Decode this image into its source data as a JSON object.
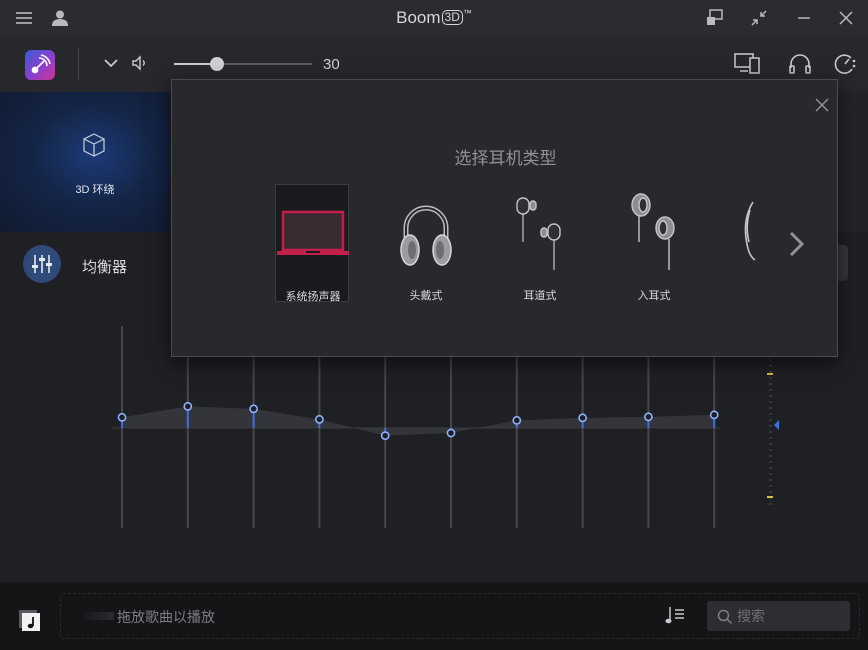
{
  "app": {
    "title_prefix": "Boom",
    "title_badge": "3D",
    "title_tm": "™"
  },
  "toolbar": {
    "volume_value": "30",
    "volume_level": 0.3
  },
  "surround": {
    "label": "3D 环绕"
  },
  "equalizer": {
    "label": "均衡器",
    "bands": [
      0.64,
      1.3,
      1.15,
      0.52,
      -0.46,
      -0.3,
      0.46,
      0.61,
      0.67,
      0.79
    ],
    "range": [
      -3,
      3
    ]
  },
  "dialog": {
    "title": "选择耳机类型",
    "options": [
      {
        "label": "系统扬声器",
        "selected": true
      },
      {
        "label": "头戴式",
        "selected": false
      },
      {
        "label": "耳道式",
        "selected": false
      },
      {
        "label": "入耳式",
        "selected": false
      }
    ]
  },
  "bottom": {
    "drop_label": "拖放歌曲以播放",
    "search_placeholder": "搜索"
  },
  "colors": {
    "accent": "#3d6fe0",
    "selected_device": "#c41e4a",
    "panel_blue": "#1d3b78"
  }
}
